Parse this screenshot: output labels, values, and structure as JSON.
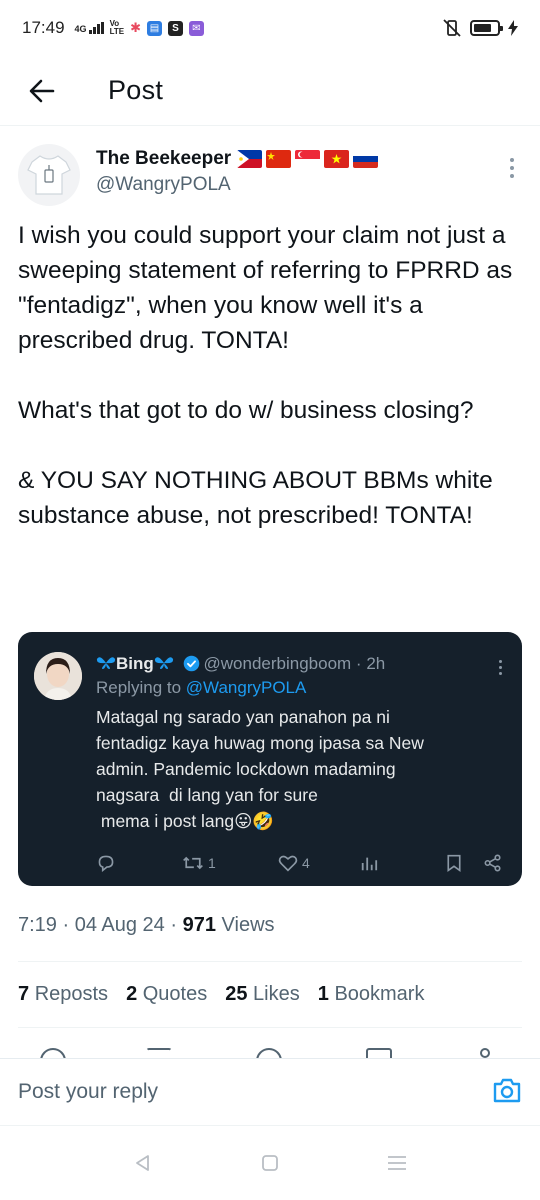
{
  "status_bar": {
    "time": "17:49",
    "network": "4G",
    "volte": "Vo\nLTE",
    "icons": [
      "signal-icon",
      "star-app-icon",
      "calendar-app-icon",
      "s-app-icon",
      "purple-app-icon",
      "mute-vibrate-icon",
      "battery-icon",
      "charging-icon"
    ],
    "battery_level": 0.75
  },
  "header": {
    "title": "Post",
    "back_icon": "arrow-left-icon"
  },
  "post": {
    "author_name": "The Beekeeper",
    "flags": [
      "philippines-flag",
      "china-flag",
      "singapore-flag",
      "vietnam-flag",
      "russia-flag"
    ],
    "author_handle": "@WangryPOLA",
    "text_paragraphs": [
      "I wish you could support your claim not just a sweeping statement of referring to FPRRD as \"fentadigz\", when you know well it's a prescribed drug. TONTA!",
      "What's that got to do w/ business closing?",
      "& YOU SAY NOTHING ABOUT BBMs white substance abuse, not prescribed! TONTA!"
    ],
    "time": "7:19",
    "date": "04 Aug 24",
    "views_count": "971",
    "views_label": "Views"
  },
  "quote": {
    "name": "Bing",
    "handle": "@wonderbingboom",
    "time": "2h",
    "replying_label": "Replying to",
    "replying_to": "@WangryPOLA",
    "text": "Matagal ng sarado yan panahon pa ni\nfentadigz kaya huwag mong ipasa sa New\nadmin. Pandemic lockdown madaming\nnagsara  di lang yan for sure\n mema i post lang😛🤣",
    "retweets": "1",
    "likes": "4"
  },
  "stats": {
    "reposts_count": "7",
    "reposts_label": "Reposts",
    "quotes_count": "2",
    "quotes_label": "Quotes",
    "likes_count": "25",
    "likes_label": "Likes",
    "bookmarks_count": "1",
    "bookmarks_label": "Bookmark"
  },
  "reply": {
    "placeholder": "Post your reply"
  },
  "colors": {
    "text": "#0f1419",
    "secondary": "#536471",
    "accent": "#1d9bf0",
    "quote_bg": "#15202b"
  }
}
